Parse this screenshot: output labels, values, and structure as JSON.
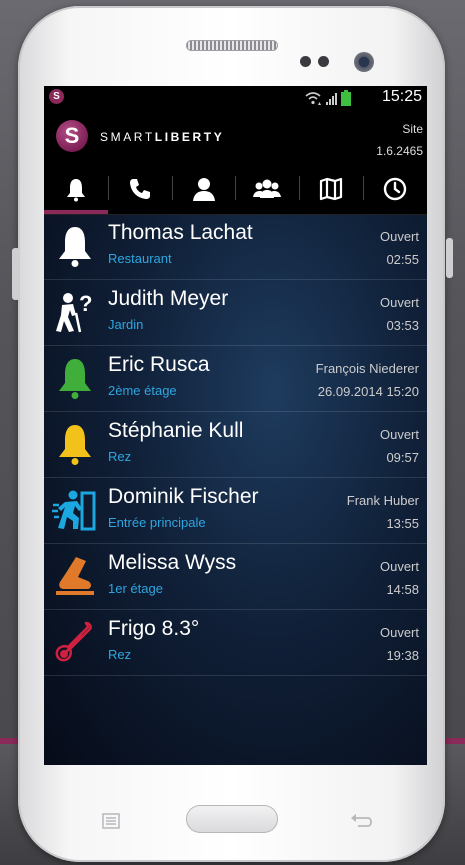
{
  "statusbar": {
    "logo_letter": "S",
    "time": "15:25"
  },
  "header": {
    "logo_letter": "S",
    "brand_light": "SMART",
    "brand_bold": "LIBERTY",
    "site_label": "Site",
    "site_version": "1.6.2465"
  },
  "tabs": [
    {
      "icon": "bell-icon",
      "active": true
    },
    {
      "icon": "phone-icon",
      "active": false
    },
    {
      "icon": "person-icon",
      "active": false
    },
    {
      "icon": "group-icon",
      "active": false
    },
    {
      "icon": "map-icon",
      "active": false
    },
    {
      "icon": "clock-icon",
      "active": false
    }
  ],
  "alerts": [
    {
      "icon": "bell-white-icon",
      "name": "Thomas Lachat",
      "location": "Restaurant",
      "status": "Ouvert",
      "time": "02:55"
    },
    {
      "icon": "fall-person-icon",
      "name": "Judith Meyer",
      "location": "Jardin",
      "status": "Ouvert",
      "time": "03:53"
    },
    {
      "icon": "bell-green-icon",
      "name": "Eric Rusca",
      "location": "2ème étage",
      "status": "François Niederer",
      "time": "26.09.2014 15:20"
    },
    {
      "icon": "bell-yellow-icon",
      "name": "Stéphanie Kull",
      "location": "Rez",
      "status": "Ouvert",
      "time": "09:57"
    },
    {
      "icon": "running-exit-icon",
      "name": "Dominik Fischer",
      "location": "Entrée principale",
      "status": "Frank Huber",
      "time": "13:55"
    },
    {
      "icon": "foot-step-icon",
      "name": "Melissa Wyss",
      "location": "1er étage",
      "status": "Ouvert",
      "time": "14:58"
    },
    {
      "icon": "thermometer-icon",
      "name": "Frigo 8.3°",
      "location": "Rez",
      "status": "Ouvert",
      "time": "19:38"
    }
  ],
  "colors": {
    "brand": "#8b2a5a",
    "location_text": "#2ea6e0",
    "bell_green": "#3fae3a",
    "bell_yellow": "#f2c21a",
    "exit_cyan": "#1ba8e0",
    "foot_orange": "#e07a2a",
    "thermo_red": "#d02040"
  }
}
